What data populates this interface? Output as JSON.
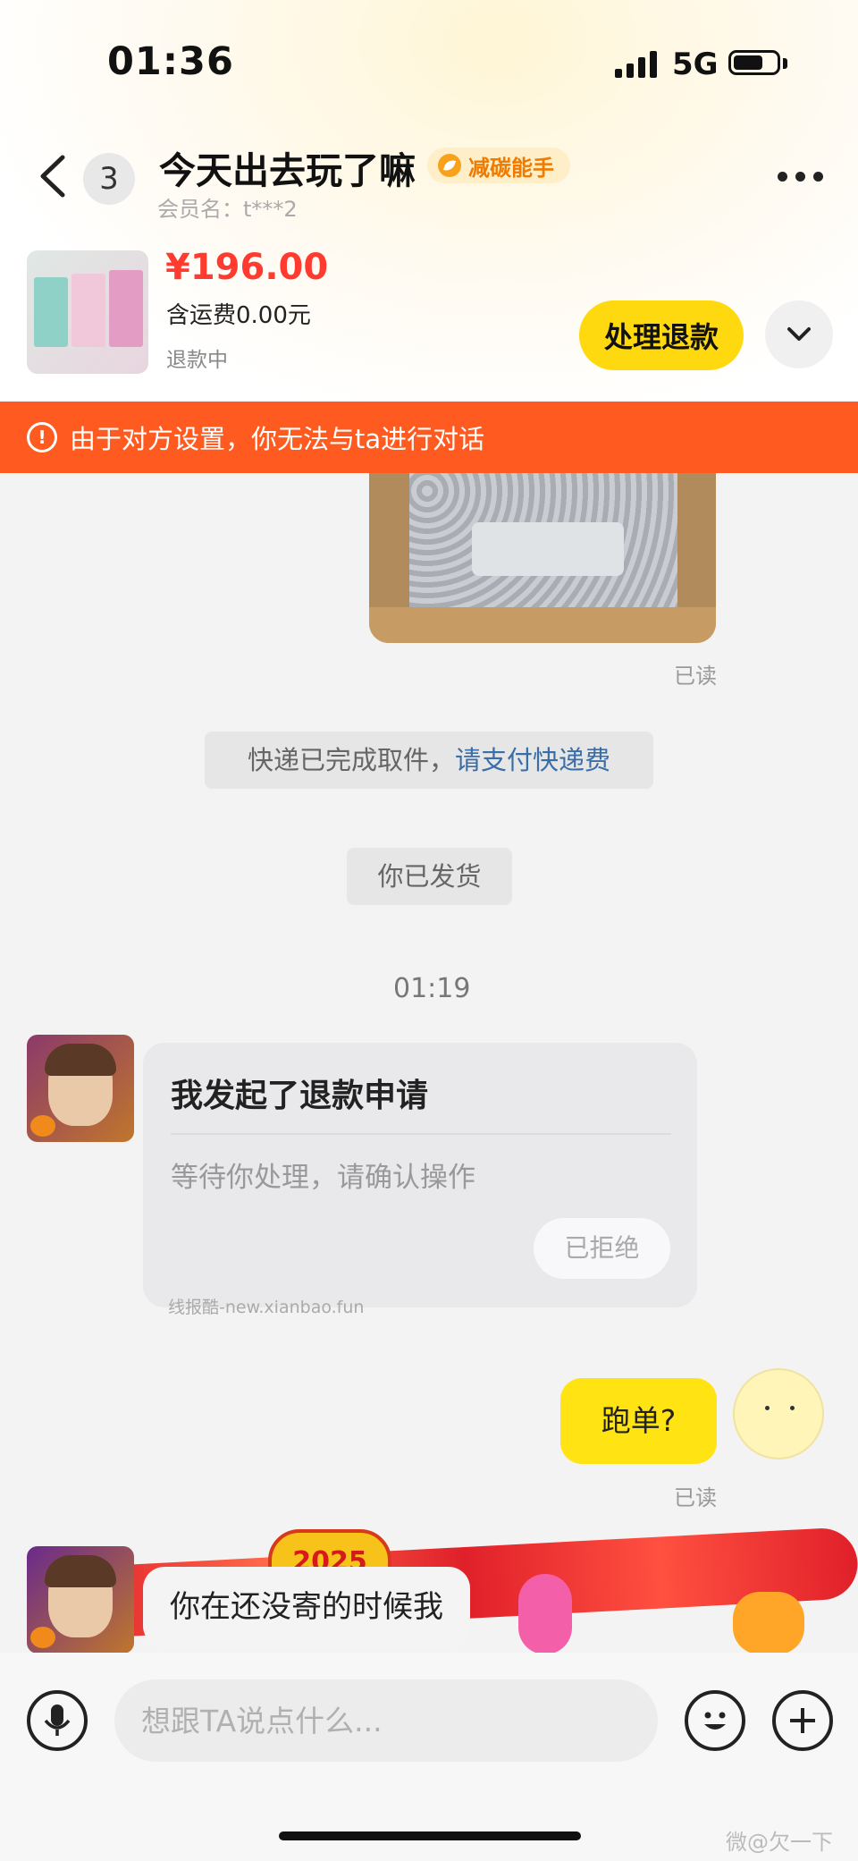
{
  "status_bar": {
    "time": "01:36",
    "network": "5G"
  },
  "header": {
    "unread_count": "3",
    "title": "今天出去玩了嘛",
    "badge": "减碳能手",
    "member": "会员名：t***2"
  },
  "product": {
    "price": "¥196.00",
    "shipping": "含运费0.00元",
    "status": "退款中",
    "refund_button": "处理退款"
  },
  "warning": "由于对方设置，你无法与ta进行对话",
  "messages": {
    "read_label_1": "已读",
    "system_1_prefix": "快递已完成取件，",
    "system_1_link": "请支付快递费",
    "system_2": "你已发货",
    "timestamp": "01:19",
    "card_title": "我发起了退款申请",
    "card_body": "等待你处理，请确认操作",
    "card_button": "已拒绝",
    "watermark": "线报酷-new.xianbao.fun",
    "my_message": "跑单?",
    "read_label_2": "已读",
    "their_message": "你在还没寄的时候我"
  },
  "festive_banner": {
    "text": "2025"
  },
  "input": {
    "placeholder": "想跟TA说点什么..."
  },
  "footer": {
    "watermark": "微@欠一下"
  },
  "colors": {
    "accent_yellow": "#ffd90f",
    "warning_orange": "#ff5a1f",
    "price_red": "#ff3b30",
    "link_blue": "#3a6ea8"
  }
}
